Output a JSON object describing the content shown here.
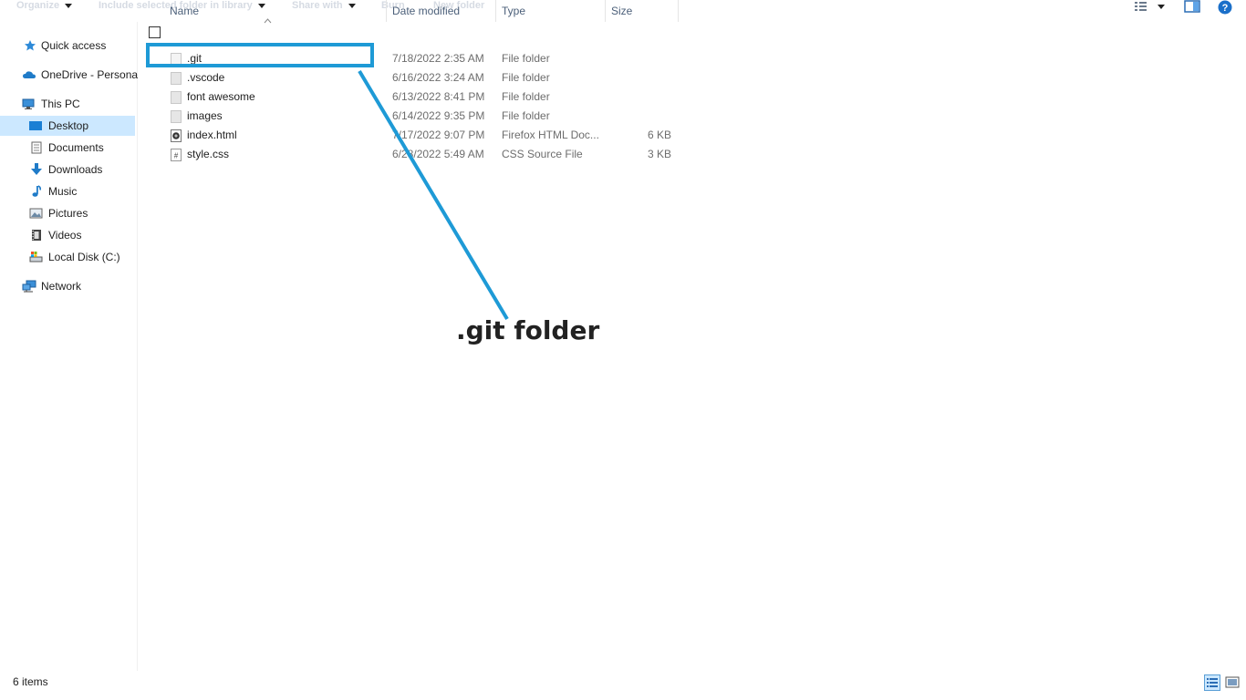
{
  "toolbar": {
    "organize": "Organize",
    "include": "Include selected folder in library",
    "share": "Share with",
    "burn": "Burn",
    "new_folder": "New folder"
  },
  "sidebar": {
    "items": [
      {
        "label": "Quick access",
        "icon": "star-icon"
      },
      {
        "label": "OneDrive - Persona",
        "icon": "cloud-icon"
      },
      {
        "label": "This PC",
        "icon": "computer-icon"
      },
      {
        "label": "Desktop",
        "icon": "desktop-icon",
        "selected": true
      },
      {
        "label": "Documents",
        "icon": "document-icon"
      },
      {
        "label": "Downloads",
        "icon": "download-arrow-icon"
      },
      {
        "label": "Music",
        "icon": "music-note-icon"
      },
      {
        "label": "Pictures",
        "icon": "picture-icon"
      },
      {
        "label": "Videos",
        "icon": "film-icon"
      },
      {
        "label": "Local Disk (C:)",
        "icon": "disk-icon"
      },
      {
        "label": "Network",
        "icon": "network-icon"
      }
    ]
  },
  "columns": {
    "name": "Name",
    "date": "Date modified",
    "type": "Type",
    "size": "Size"
  },
  "files": [
    {
      "name": ".git",
      "date": "7/18/2022 2:35 AM",
      "type": "File folder",
      "size": ""
    },
    {
      "name": ".vscode",
      "date": "6/16/2022 3:24 AM",
      "type": "File folder",
      "size": ""
    },
    {
      "name": "font awesome",
      "date": "6/13/2022 8:41 PM",
      "type": "File folder",
      "size": ""
    },
    {
      "name": "images",
      "date": "6/14/2022 9:35 PM",
      "type": "File folder",
      "size": ""
    },
    {
      "name": "index.html",
      "date": "7/17/2022 9:07 PM",
      "type": "Firefox HTML Doc...",
      "size": "6 KB"
    },
    {
      "name": "style.css",
      "date": "6/28/2022 5:49 AM",
      "type": "CSS Source File",
      "size": "3 KB"
    }
  ],
  "annotation": {
    "text": ".git folder",
    "color": "#1e9ad6"
  },
  "status": {
    "items": "6 items"
  }
}
